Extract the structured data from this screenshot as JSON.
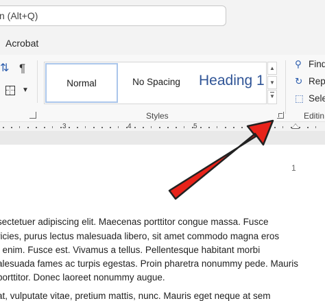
{
  "search": {
    "text": "n (Alt+Q)"
  },
  "tabs": {
    "visible": [
      "Acrobat"
    ]
  },
  "ribbon": {
    "styles_group": {
      "label": "Styles",
      "items": [
        "Normal",
        "No Spacing",
        "Heading 1"
      ],
      "selected": "Normal"
    },
    "editing_group": {
      "label": "Editin",
      "find": "Find",
      "replace": "Repl",
      "select": "Sele"
    }
  },
  "ruler": {
    "labels": [
      "3",
      "4",
      "5"
    ]
  },
  "document": {
    "page_number": "1",
    "lines": [
      "sectetuer adipiscing elit. Maecenas porttitor congue massa. Fusce",
      "ricies, purus lectus malesuada libero, sit amet commodo magna eros",
      "t enim. Fusce est. Vivamus a tellus. Pellentesque habitant morbi",
      "alesuada fames ac turpis egestas. Proin pharetra nonummy pede. Mauris",
      "porttitor. Donec laoreet nonummy augue.",
      "at, vulputate vitae, pretium mattis, nunc. Mauris eget neque at sem"
    ]
  },
  "annotation": {
    "arrow_color": "#e8231a"
  },
  "icons": [
    "sort-icon",
    "pilcrow-icon",
    "borders-icon",
    "find-icon",
    "replace-icon",
    "select-icon",
    "dialog-launcher-icon"
  ]
}
